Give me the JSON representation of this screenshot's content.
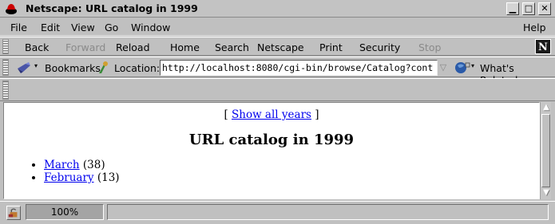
{
  "window": {
    "title": "Netscape: URL catalog in 1999",
    "min_icon": "minimize-icon",
    "max_icon": "maximize-icon",
    "close_icon": "close-icon"
  },
  "menubar": {
    "file": "File",
    "edit": "Edit",
    "view": "View",
    "go": "Go",
    "window": "Window",
    "help": "Help"
  },
  "toolbar": {
    "back": "Back",
    "forward": "Forward",
    "reload": "Reload",
    "home": "Home",
    "search": "Search",
    "netscape": "Netscape",
    "print": "Print",
    "security": "Security",
    "stop": "Stop",
    "logo": "N"
  },
  "location": {
    "bookmarks": "Bookmarks",
    "label": "Location:",
    "url": "http://localhost:8080/cgi-bin/browse/Catalog?cont",
    "whats_related": "What's Related"
  },
  "page": {
    "show_all_open": "[",
    "show_all": "Show all years",
    "show_all_close": "]",
    "title": "URL catalog in 1999",
    "months": [
      {
        "name": "March",
        "count": "(38)"
      },
      {
        "name": "February",
        "count": "(13)"
      }
    ]
  },
  "status": {
    "progress": "100%"
  },
  "colors": {
    "link": "#0000ee",
    "chrome": "#c0c0c0",
    "background": "#ffffff"
  }
}
